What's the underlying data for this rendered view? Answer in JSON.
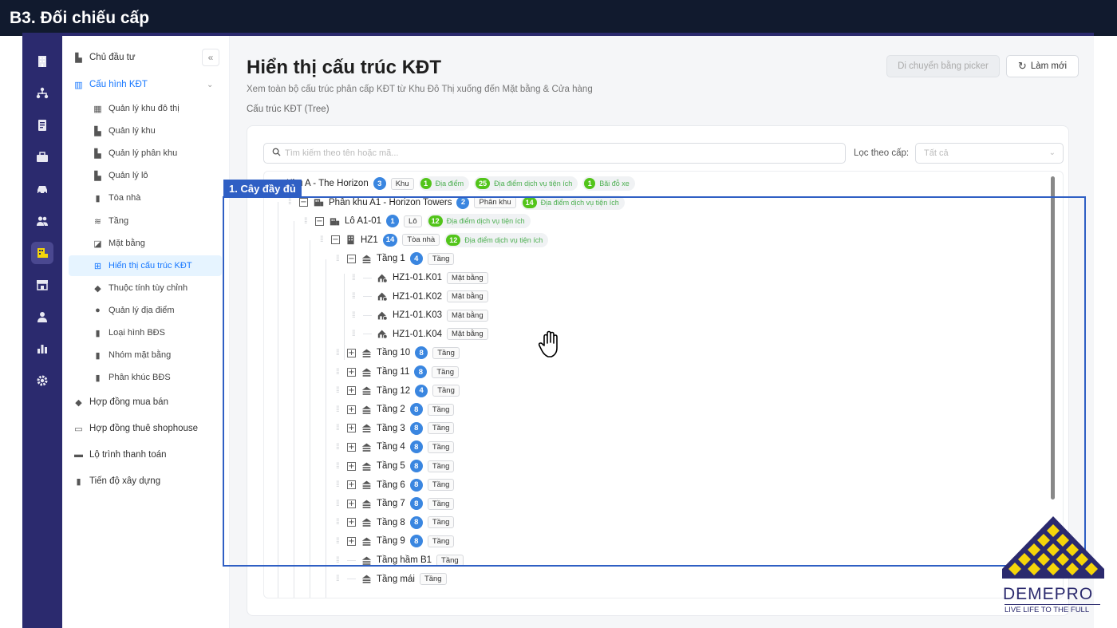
{
  "slide_title": "B3. Đối chiếu cấp",
  "rail": {
    "icons": [
      "building-icon",
      "network-icon",
      "document-icon",
      "briefcase-icon",
      "car-icon",
      "users-icon",
      "office-icon",
      "store-icon",
      "person-icon",
      "chart-icon",
      "settings-icon"
    ],
    "active_index": 6
  },
  "sidebar": {
    "items": [
      {
        "label": "Chủ đầu tư",
        "icon": "investor-icon",
        "level": 1
      },
      {
        "label": "Cấu hình KĐT",
        "icon": "bank-icon",
        "level": 1,
        "expanded": true
      },
      {
        "label": "Quản lý khu đô thị",
        "icon": "city-icon",
        "level": 2
      },
      {
        "label": "Quản lý khu",
        "icon": "zone-icon",
        "level": 2
      },
      {
        "label": "Quản lý phân khu",
        "icon": "subzone-icon",
        "level": 2
      },
      {
        "label": "Quản lý lô",
        "icon": "lot-icon",
        "level": 2
      },
      {
        "label": "Tòa nhà",
        "icon": "building-icon",
        "level": 2
      },
      {
        "label": "Tầng",
        "icon": "layers-icon",
        "level": 2
      },
      {
        "label": "Mặt bằng",
        "icon": "floorplan-icon",
        "level": 2
      },
      {
        "label": "Hiển thị cấu trúc KĐT",
        "icon": "tree-icon",
        "level": 2,
        "selected": true
      },
      {
        "label": "Thuộc tính tùy chỉnh",
        "icon": "tag-icon",
        "level": 2
      },
      {
        "label": "Quản lý địa điểm",
        "icon": "location-icon",
        "level": 2
      },
      {
        "label": "Loại hình BĐS",
        "icon": "building-icon",
        "level": 2
      },
      {
        "label": "Nhóm mặt bằng",
        "icon": "building-icon",
        "level": 2
      },
      {
        "label": "Phân khúc BĐS",
        "icon": "building-icon",
        "level": 2
      },
      {
        "label": "Hợp đồng mua bán",
        "icon": "tag-icon",
        "level": 1
      },
      {
        "label": "Hợp đồng thuê shophouse",
        "icon": "shop-icon",
        "level": 1
      },
      {
        "label": "Lộ trình thanh toán",
        "icon": "payment-icon",
        "level": 1
      },
      {
        "label": "Tiến độ xây dựng",
        "icon": "building-icon",
        "level": 1
      }
    ]
  },
  "page": {
    "title": "Hiển thị cấu trúc KĐT",
    "description": "Xem toàn bộ cấu trúc phân cấp KĐT từ Khu Đô Thị xuống đến Mặt bằng & Cửa hàng",
    "section_label": "Cấu trúc KĐT (Tree)",
    "btn_move": "Di chuyển bằng picker",
    "btn_refresh": "Làm mới"
  },
  "search": {
    "placeholder": "Tìm kiếm theo tên hoặc mã..."
  },
  "filter": {
    "label": "Lọc theo cấp:",
    "value": "Tất cả"
  },
  "tree": [
    {
      "label": "Khu A - The Horizon",
      "count": "3",
      "type": "Khu",
      "depth": 0,
      "toggle": "",
      "stats": [
        {
          "n": "1",
          "t": "Địa điểm"
        },
        {
          "n": "25",
          "t": "Địa điểm dịch vụ tiện ích"
        },
        {
          "n": "1",
          "t": "Bãi đỗ xe"
        }
      ]
    },
    {
      "label": "Phân khu A1 - Horizon Towers",
      "count": "2",
      "type": "Phân khu",
      "depth": 1,
      "toggle": "−",
      "stats": [
        {
          "n": "14",
          "t": "Địa điểm dịch vụ tiện ích"
        }
      ]
    },
    {
      "label": "Lô A1-01",
      "count": "1",
      "type": "Lô",
      "depth": 2,
      "toggle": "−",
      "stats": [
        {
          "n": "12",
          "t": "Địa điểm dịch vụ tiện ích"
        }
      ]
    },
    {
      "label": "HZ1",
      "count": "14",
      "type": "Tòa nhà",
      "depth": 3,
      "toggle": "−",
      "stats": [
        {
          "n": "12",
          "t": "Địa điểm dịch vụ tiện ích"
        }
      ]
    },
    {
      "label": "Tầng 1",
      "count": "4",
      "type": "Tầng",
      "depth": 4,
      "toggle": "−",
      "stats": []
    },
    {
      "label": "HZ1-01.K01",
      "count": "",
      "type": "Mặt bằng",
      "depth": 5,
      "toggle": "",
      "stats": []
    },
    {
      "label": "HZ1-01.K02",
      "count": "",
      "type": "Mặt bằng",
      "depth": 5,
      "toggle": "",
      "stats": []
    },
    {
      "label": "HZ1-01.K03",
      "count": "",
      "type": "Mặt bằng",
      "depth": 5,
      "toggle": "",
      "stats": []
    },
    {
      "label": "HZ1-01.K04",
      "count": "",
      "type": "Mặt bằng",
      "depth": 5,
      "toggle": "",
      "stats": []
    },
    {
      "label": "Tầng 10",
      "count": "8",
      "type": "Tầng",
      "depth": 4,
      "toggle": "+",
      "stats": []
    },
    {
      "label": "Tầng 11",
      "count": "8",
      "type": "Tầng",
      "depth": 4,
      "toggle": "+",
      "stats": []
    },
    {
      "label": "Tầng 12",
      "count": "4",
      "type": "Tầng",
      "depth": 4,
      "toggle": "+",
      "stats": []
    },
    {
      "label": "Tầng 2",
      "count": "8",
      "type": "Tầng",
      "depth": 4,
      "toggle": "+",
      "stats": []
    },
    {
      "label": "Tầng 3",
      "count": "8",
      "type": "Tầng",
      "depth": 4,
      "toggle": "+",
      "stats": []
    },
    {
      "label": "Tầng 4",
      "count": "8",
      "type": "Tầng",
      "depth": 4,
      "toggle": "+",
      "stats": []
    },
    {
      "label": "Tầng 5",
      "count": "8",
      "type": "Tầng",
      "depth": 4,
      "toggle": "+",
      "stats": []
    },
    {
      "label": "Tầng 6",
      "count": "8",
      "type": "Tầng",
      "depth": 4,
      "toggle": "+",
      "stats": []
    },
    {
      "label": "Tầng 7",
      "count": "8",
      "type": "Tầng",
      "depth": 4,
      "toggle": "+",
      "stats": []
    },
    {
      "label": "Tầng 8",
      "count": "8",
      "type": "Tầng",
      "depth": 4,
      "toggle": "+",
      "stats": []
    },
    {
      "label": "Tầng 9",
      "count": "8",
      "type": "Tầng",
      "depth": 4,
      "toggle": "+",
      "stats": []
    },
    {
      "label": "Tầng hầm B1",
      "count": "",
      "type": "Tầng",
      "depth": 4,
      "toggle": "",
      "stats": []
    },
    {
      "label": "Tầng mái",
      "count": "",
      "type": "Tầng",
      "depth": 4,
      "toggle": "",
      "stats": []
    }
  ],
  "highlight": {
    "label": "1. Cây đầy đủ"
  },
  "logo": {
    "name": "DEMEPRO",
    "tagline": "LIVE LIFE TO THE FULL"
  },
  "colors": {
    "rail": "#2b2a6e",
    "accent": "#1677ff",
    "count_badge": "#3a86e0",
    "stat_green": "#52c41a",
    "highlight": "#2f5fc4",
    "logo_yellow": "#f5d50a"
  }
}
